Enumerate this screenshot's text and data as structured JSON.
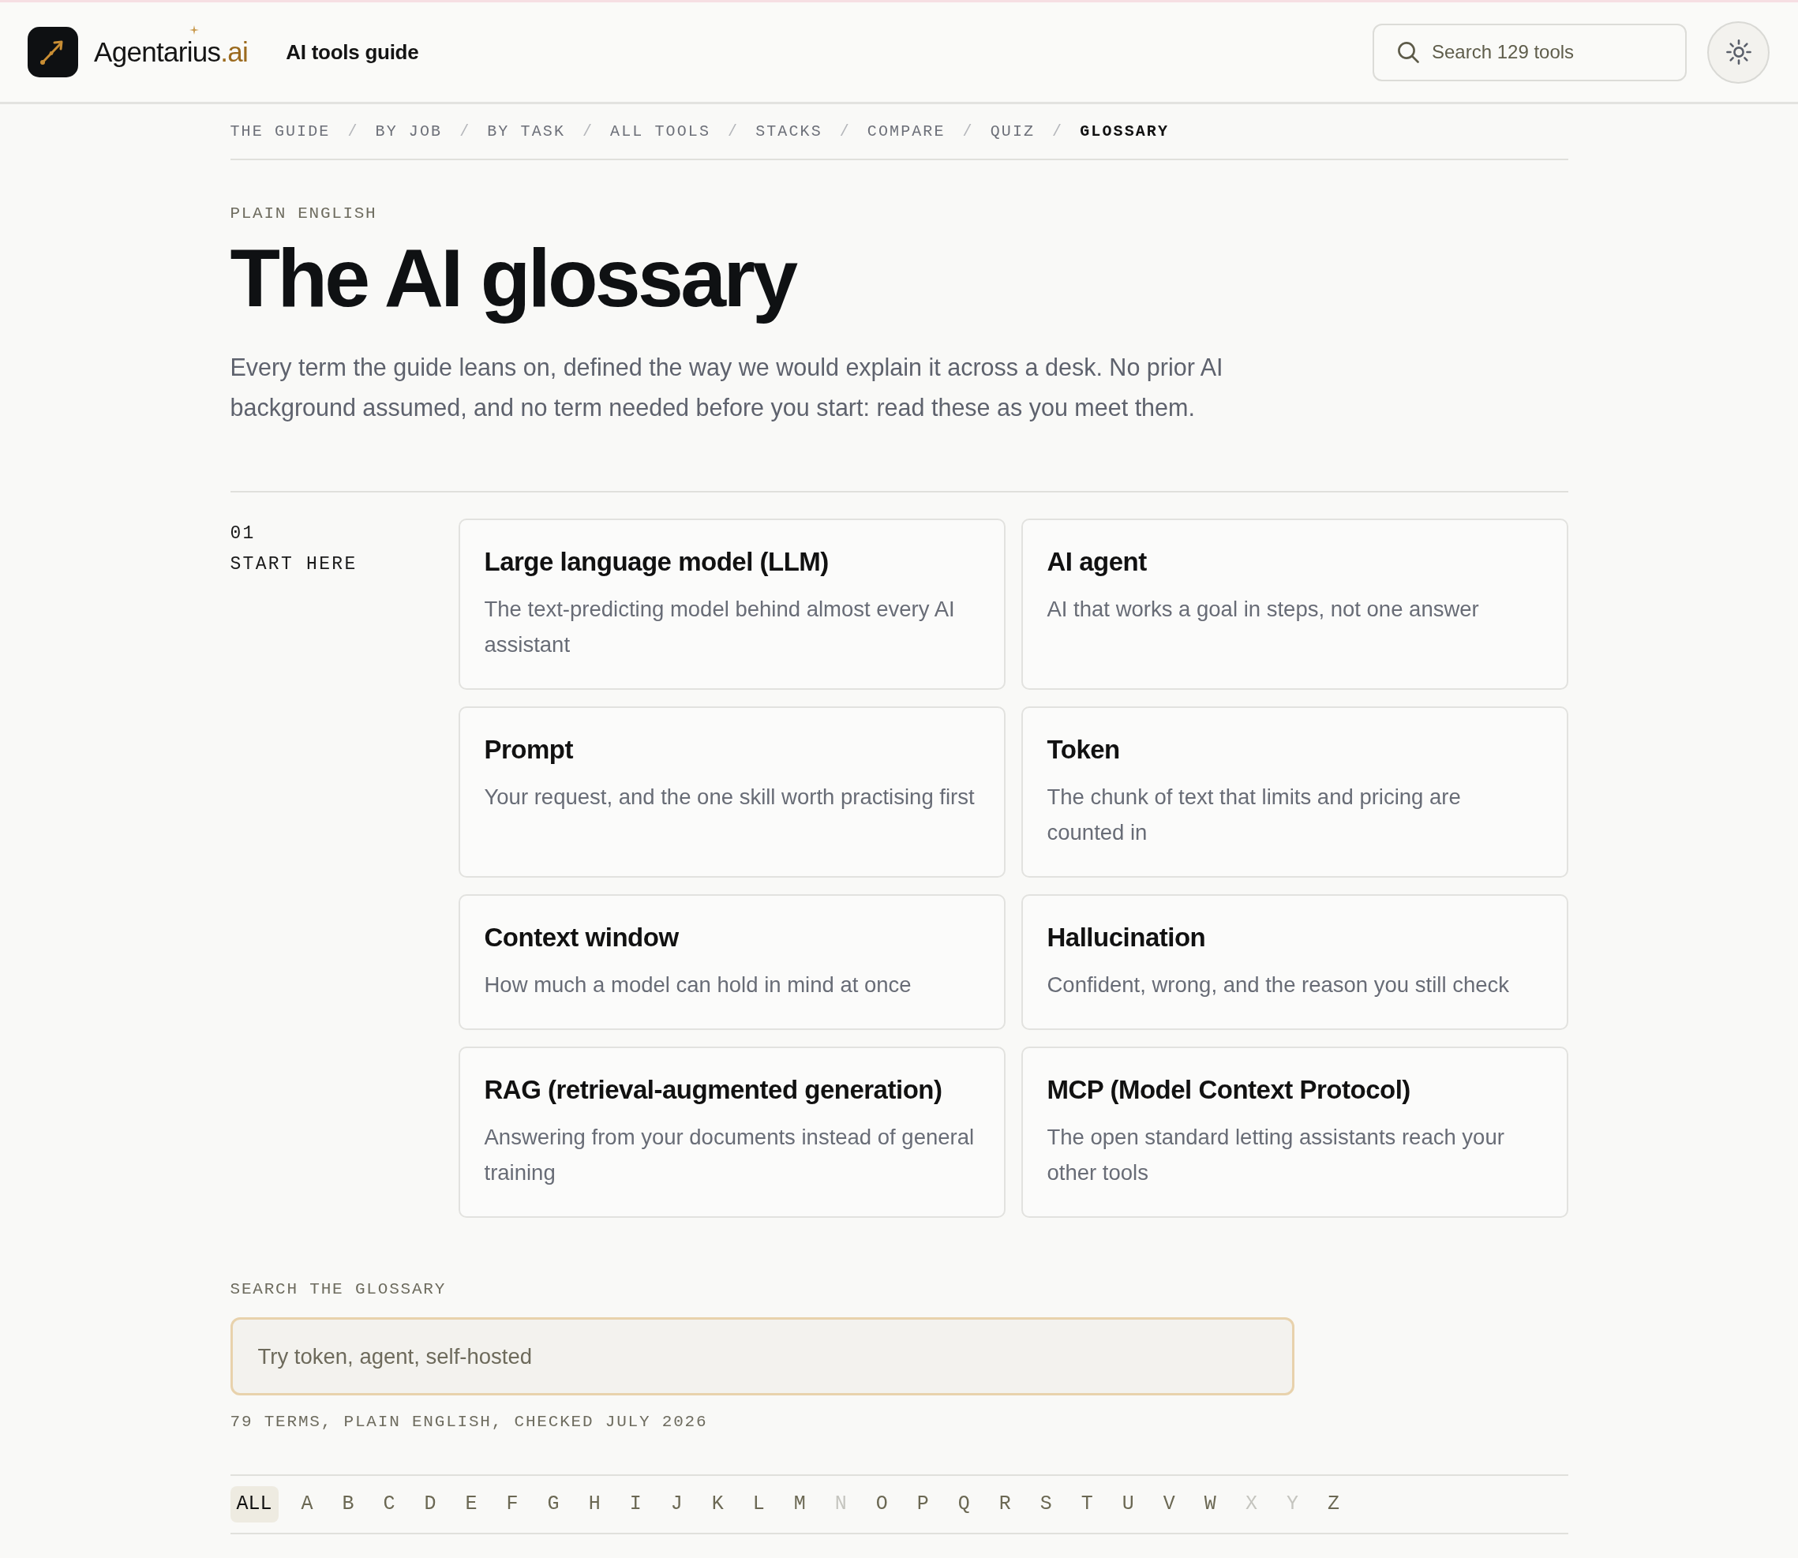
{
  "header": {
    "brand": {
      "name": "Agentarius",
      "suffix": ".ai"
    },
    "section_title": "AI tools guide",
    "search": {
      "placeholder": "Search 129 tools"
    }
  },
  "breadcrumb": [
    {
      "label": "THE GUIDE",
      "selected": false,
      "separator": "/"
    },
    {
      "label": "BY JOB",
      "selected": false,
      "separator": "/"
    },
    {
      "label": "BY TASK",
      "selected": false,
      "separator": "/"
    },
    {
      "label": "ALL TOOLS",
      "selected": false,
      "separator": "/"
    },
    {
      "label": "STACKS",
      "selected": false,
      "separator": "/"
    },
    {
      "label": "COMPARE",
      "selected": false,
      "separator": "/"
    },
    {
      "label": "QUIZ",
      "selected": false,
      "separator": "/"
    },
    {
      "label": "GLOSSARY",
      "selected": true
    }
  ],
  "page": {
    "eyebrow": "PLAIN ENGLISH",
    "title": "The AI glossary",
    "lead": "Every term the guide leans on, defined the way we would explain it across a desk. No prior AI background assumed, and no term needed before you start: read these as you meet them."
  },
  "sections": [
    {
      "number": "01",
      "title": "START HERE",
      "terms": [
        {
          "term": "Large language model (LLM)",
          "definition": "The text-predicting model behind almost every AI assistant"
        },
        {
          "term": "AI agent",
          "definition": "AI that works a goal in steps, not one answer"
        },
        {
          "term": "Prompt",
          "definition": "Your request, and the one skill worth practising first"
        },
        {
          "term": "Token",
          "definition": "The chunk of text that limits and pricing are counted in"
        },
        {
          "term": "Context window",
          "definition": "How much a model can hold in mind at once"
        },
        {
          "term": "Hallucination",
          "definition": "Confident, wrong, and the reason you still check"
        },
        {
          "term": "RAG (retrieval-augmented generation)",
          "definition": "Answering from your documents instead of general training"
        },
        {
          "term": "MCP (Model Context Protocol)",
          "definition": "The open standard letting assistants reach your other tools"
        }
      ]
    }
  ],
  "glossary_search": {
    "label": "SEARCH THE GLOSSARY",
    "placeholder": "Try token, agent, self-hosted",
    "focused": true,
    "caption": "79 TERMS, PLAIN ENGLISH, CHECKED JULY 2026"
  },
  "alphabet": [
    {
      "label": "ALL",
      "selected": true,
      "disabled": false
    },
    {
      "label": "A",
      "selected": false,
      "disabled": false
    },
    {
      "label": "B",
      "selected": false,
      "disabled": false
    },
    {
      "label": "C",
      "selected": false,
      "disabled": false
    },
    {
      "label": "D",
      "selected": false,
      "disabled": false
    },
    {
      "label": "E",
      "selected": false,
      "disabled": false
    },
    {
      "label": "F",
      "selected": false,
      "disabled": false
    },
    {
      "label": "G",
      "selected": false,
      "disabled": false
    },
    {
      "label": "H",
      "selected": false,
      "disabled": false
    },
    {
      "label": "I",
      "selected": false,
      "disabled": false
    },
    {
      "label": "J",
      "selected": false,
      "disabled": false
    },
    {
      "label": "K",
      "selected": false,
      "disabled": false
    },
    {
      "label": "L",
      "selected": false,
      "disabled": false
    },
    {
      "label": "M",
      "selected": false,
      "disabled": false
    },
    {
      "label": "N",
      "selected": false,
      "disabled": true
    },
    {
      "label": "O",
      "selected": false,
      "disabled": false
    },
    {
      "label": "P",
      "selected": false,
      "disabled": false
    },
    {
      "label": "Q",
      "selected": false,
      "disabled": false
    },
    {
      "label": "R",
      "selected": false,
      "disabled": false
    },
    {
      "label": "S",
      "selected": false,
      "disabled": false
    },
    {
      "label": "T",
      "selected": false,
      "disabled": false
    },
    {
      "label": "U",
      "selected": false,
      "disabled": false
    },
    {
      "label": "V",
      "selected": false,
      "disabled": false
    },
    {
      "label": "W",
      "selected": false,
      "disabled": false
    },
    {
      "label": "X",
      "selected": false,
      "disabled": true
    },
    {
      "label": "Y",
      "selected": false,
      "disabled": true
    },
    {
      "label": "Z",
      "selected": false,
      "disabled": false
    }
  ]
}
